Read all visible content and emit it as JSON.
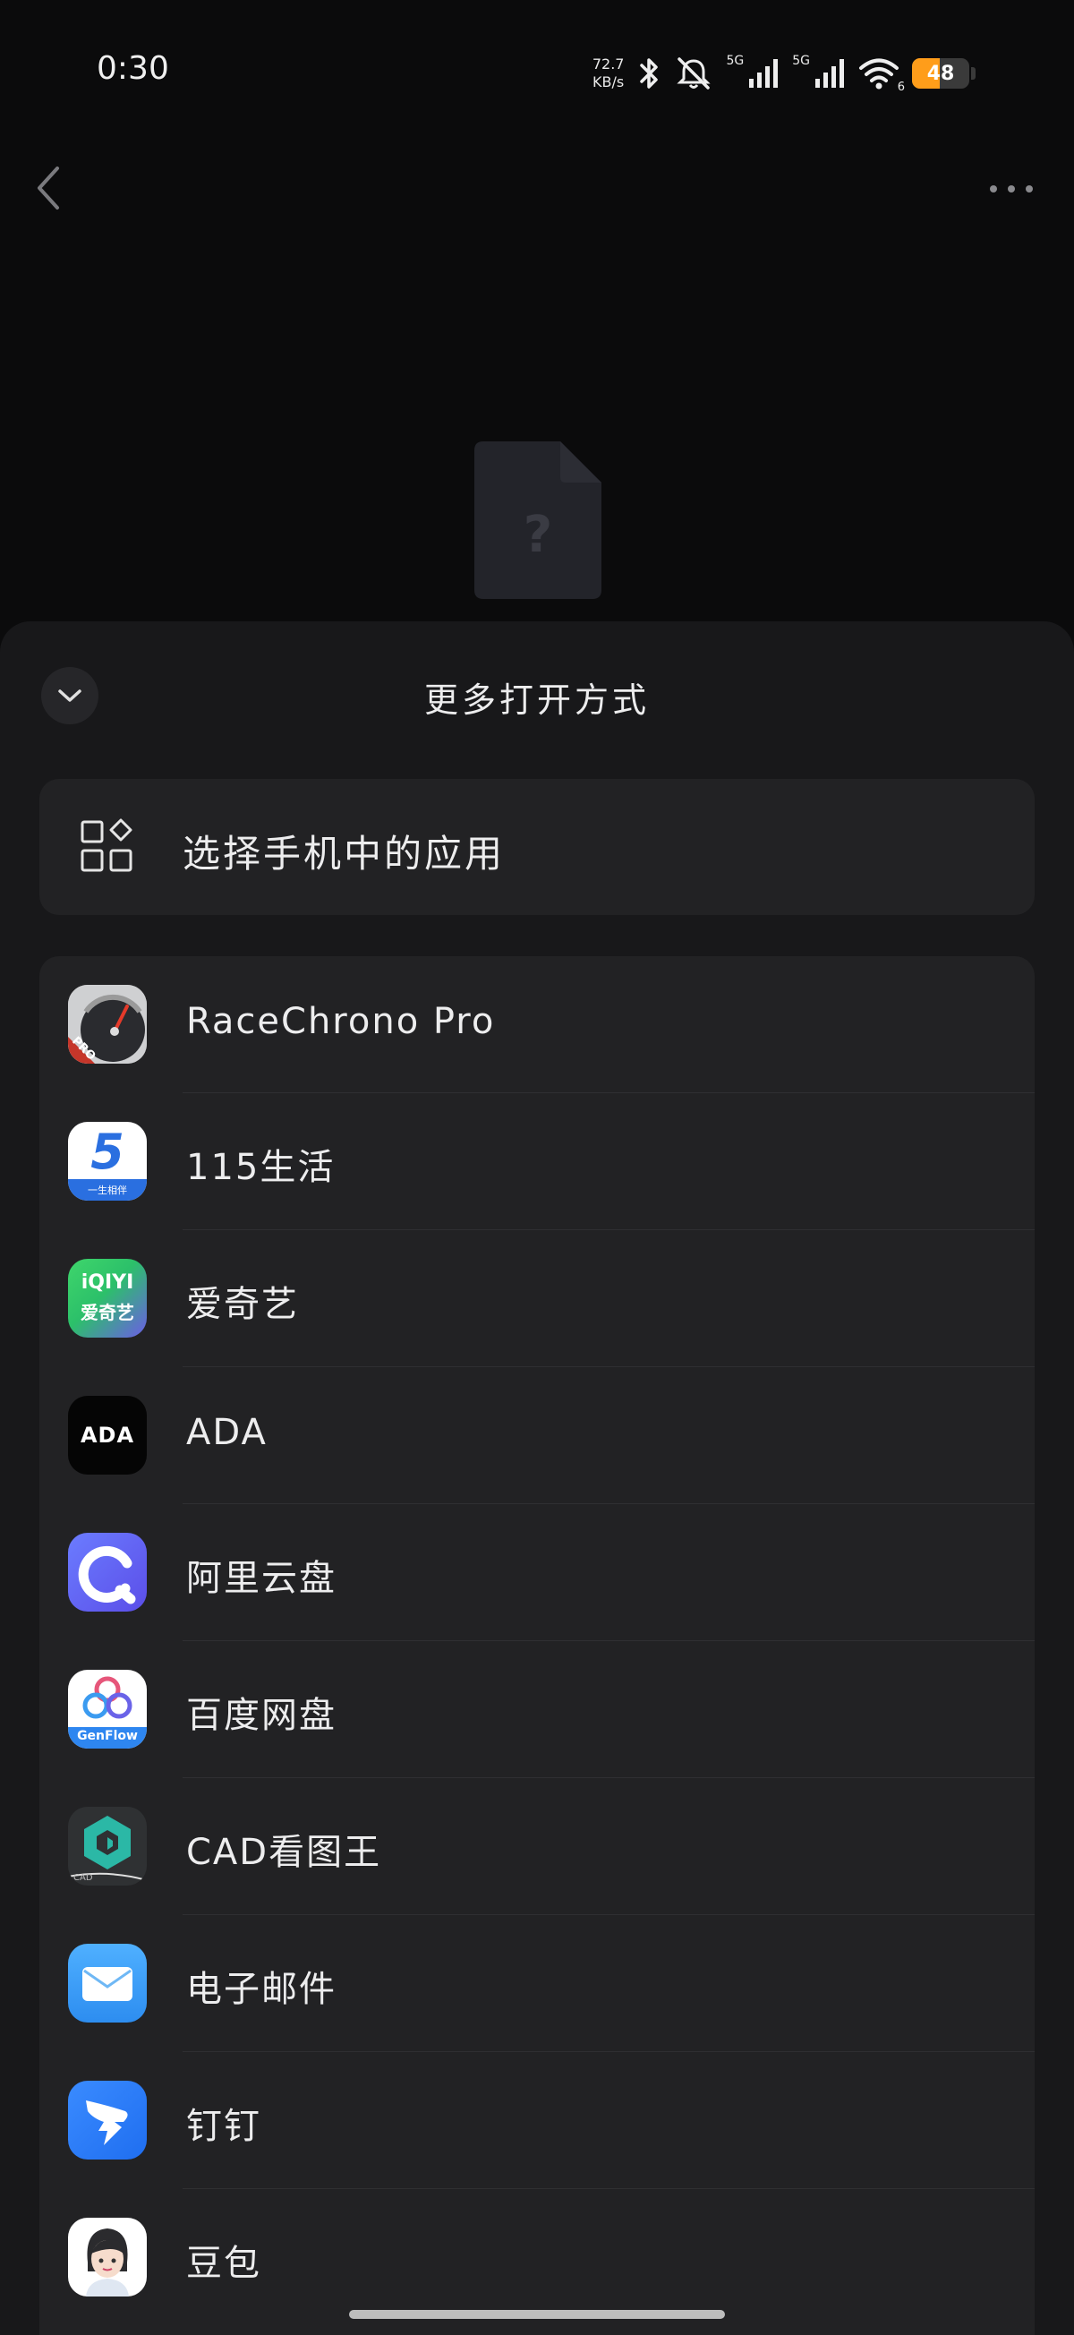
{
  "status_bar": {
    "time": "0:30",
    "net_speed_value": "72.7",
    "net_speed_unit": "KB/s",
    "sim1_label": "5G",
    "sim2_label": "5G",
    "wifi_label": "6",
    "battery": "48",
    "battery_level": 0.48,
    "battery_color": "#ff9d1a"
  },
  "nav": {
    "back_icon": "chevron-left-icon",
    "more_icon": "more-dots-icon"
  },
  "preview": {
    "mark": "?"
  },
  "sheet": {
    "title": "更多打开方式",
    "choose_label": "选择手机中的应用",
    "apps": [
      {
        "name": "RaceChrono Pro",
        "icon": "racechrono-icon"
      },
      {
        "name": "115生活",
        "icon": "115-icon"
      },
      {
        "name": "爱奇艺",
        "icon": "iqiyi-icon"
      },
      {
        "name": "ADA",
        "icon": "ada-icon"
      },
      {
        "name": "阿里云盘",
        "icon": "aliyun-drive-icon"
      },
      {
        "name": "百度网盘",
        "icon": "baidu-netdisk-icon"
      },
      {
        "name": "CAD看图王",
        "icon": "cad-icon"
      },
      {
        "name": "电子邮件",
        "icon": "email-icon"
      },
      {
        "name": "钉钉",
        "icon": "dingtalk-icon"
      },
      {
        "name": "豆包",
        "icon": "doubao-icon"
      }
    ],
    "icon_texts": {
      "racechrono_badge": "PRO",
      "num115": "5",
      "num115_sub": "一生相伴",
      "iqiyi_top": "iQIYI",
      "iqiyi_bottom": "爱奇艺",
      "ada_logo": "ADA",
      "baidu_badge": "GenFlow",
      "cad_badge": "CAD"
    }
  },
  "colors": {
    "background": "#0b0b0c",
    "sheet": "#18181a",
    "card": "#222224",
    "text": "#ededee"
  }
}
